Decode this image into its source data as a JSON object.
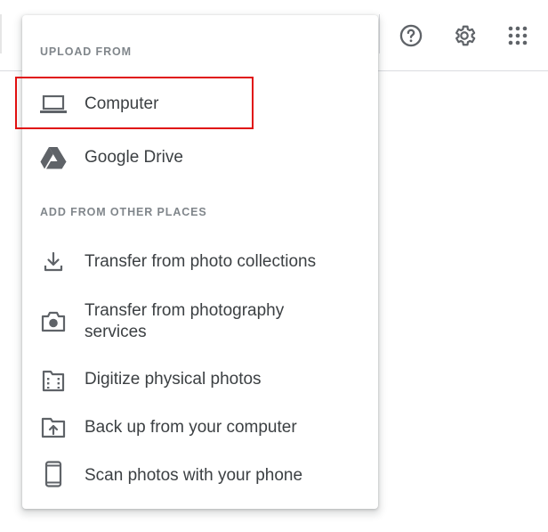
{
  "upload_menu": {
    "upload_from": {
      "heading": "UPLOAD FROM",
      "items": [
        {
          "label": "Computer",
          "icon": "laptop-icon",
          "highlighted": true
        },
        {
          "label": "Google Drive",
          "icon": "google-drive-icon"
        }
      ]
    },
    "add_from_other_places": {
      "heading": "ADD FROM OTHER PLACES",
      "items": [
        {
          "label": "Transfer from photo collections",
          "icon": "download-icon"
        },
        {
          "label": "Transfer from photography services",
          "icon": "camera-icon"
        },
        {
          "label": "Digitize physical photos",
          "icon": "film-folder-icon"
        },
        {
          "label": "Back up from your computer",
          "icon": "folder-upload-icon"
        },
        {
          "label": "Scan photos with your phone",
          "icon": "smartphone-icon"
        }
      ]
    }
  },
  "toolbar": {
    "icons": [
      "help-icon",
      "settings-icon",
      "apps-grid-icon"
    ]
  },
  "colors": {
    "highlight_border": "#e01010",
    "section_heading": "#80868b",
    "item_text": "#3c4043",
    "icon": "#5f6368"
  }
}
